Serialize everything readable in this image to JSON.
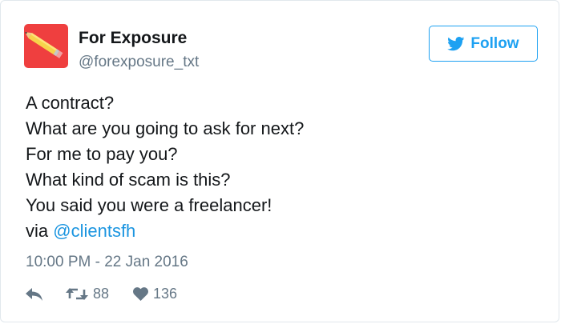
{
  "tweet": {
    "author_name": "For Exposure",
    "author_handle": "@forexposure_txt",
    "follow_label": "Follow",
    "lines": [
      "A contract?",
      "What are you going to ask for next?",
      "For me to pay you?",
      "What kind of scam is this?",
      "You said you were a freelancer!"
    ],
    "via_prefix": "via",
    "via_mention": "@clientsfh",
    "timestamp": "10:00 PM - 22 Jan 2016",
    "retweet_count": "88",
    "like_count": "136"
  },
  "icons": {
    "avatar": "pencil-avatar",
    "follow": "twitter-bird-icon",
    "reply": "reply-icon",
    "retweet": "retweet-icon",
    "like": "heart-icon"
  },
  "colors": {
    "brand_blue": "#1da1f2",
    "mention_blue": "#1b95e0",
    "avatar_red": "#ef3f3f",
    "muted_gray": "#657786",
    "text": "#14171a"
  }
}
